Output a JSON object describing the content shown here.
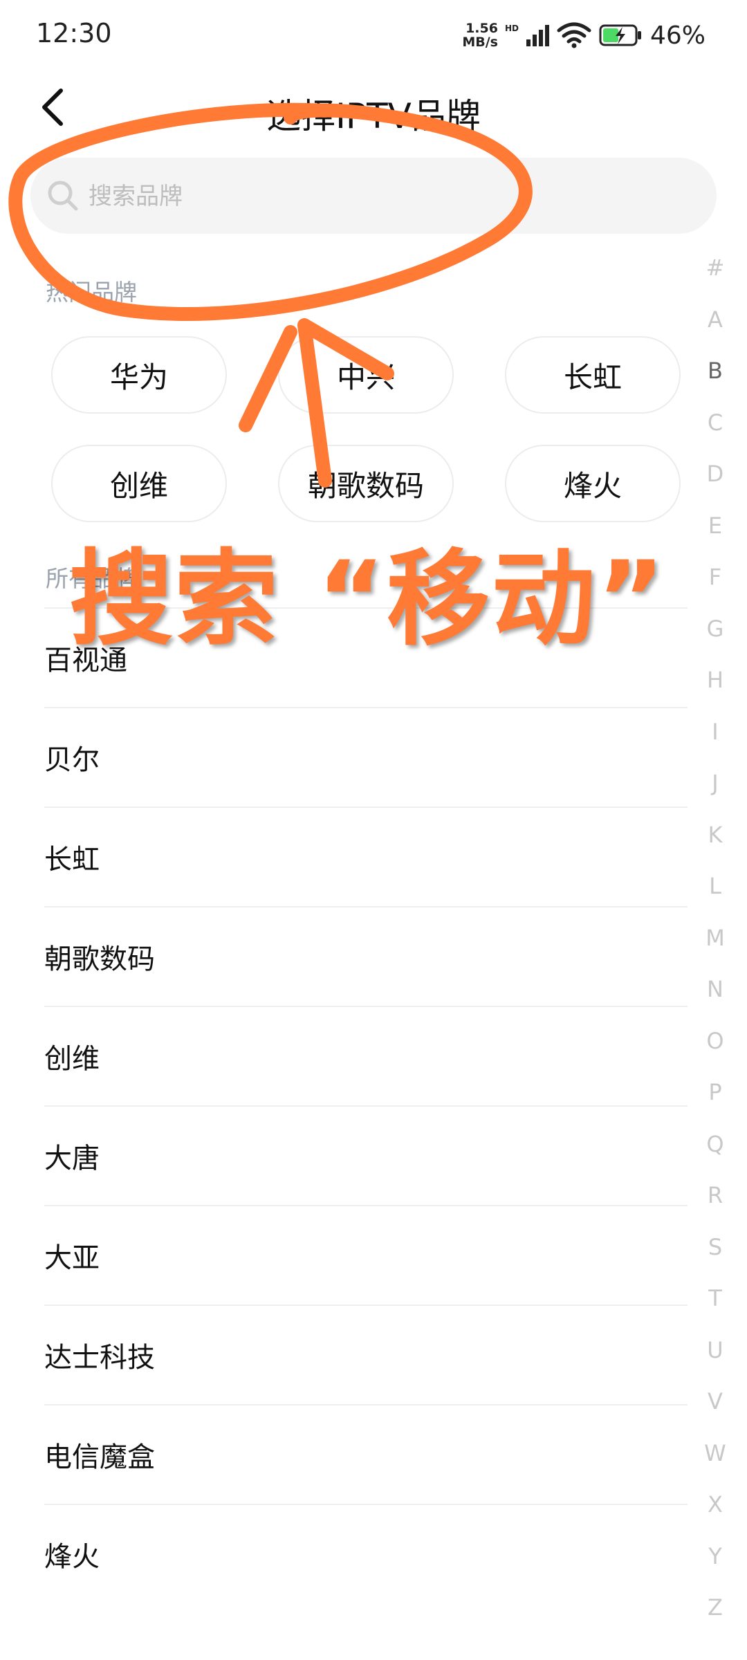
{
  "status_bar": {
    "time": "12:30",
    "net_speed_value": "1.56",
    "net_speed_unit": "MB/s",
    "hd_label": "HD",
    "battery": "46%"
  },
  "header": {
    "title": "选择IPTV品牌",
    "back_icon": "chevron-left-icon"
  },
  "search": {
    "placeholder": "搜索品牌",
    "icon": "search-icon"
  },
  "hot_section": {
    "label": "热门品牌",
    "brands": [
      "华为",
      "中兴",
      "长虹",
      "创维",
      "朝歌数码",
      "烽火"
    ]
  },
  "all_section": {
    "label": "所有品牌",
    "brands": [
      "百视通",
      "贝尔",
      "长虹",
      "朝歌数码",
      "创维",
      "大唐",
      "大亚",
      "达士科技",
      "电信魔盒",
      "烽火"
    ]
  },
  "index_bar": {
    "letters": [
      "#",
      "A",
      "B",
      "C",
      "D",
      "E",
      "F",
      "G",
      "H",
      "I",
      "J",
      "K",
      "L",
      "M",
      "N",
      "O",
      "P",
      "Q",
      "R",
      "S",
      "T",
      "U",
      "V",
      "W",
      "X",
      "Y",
      "Z"
    ],
    "active": "B"
  },
  "annotation": {
    "text": "搜索  “移动”",
    "color": "#ff7a35"
  }
}
